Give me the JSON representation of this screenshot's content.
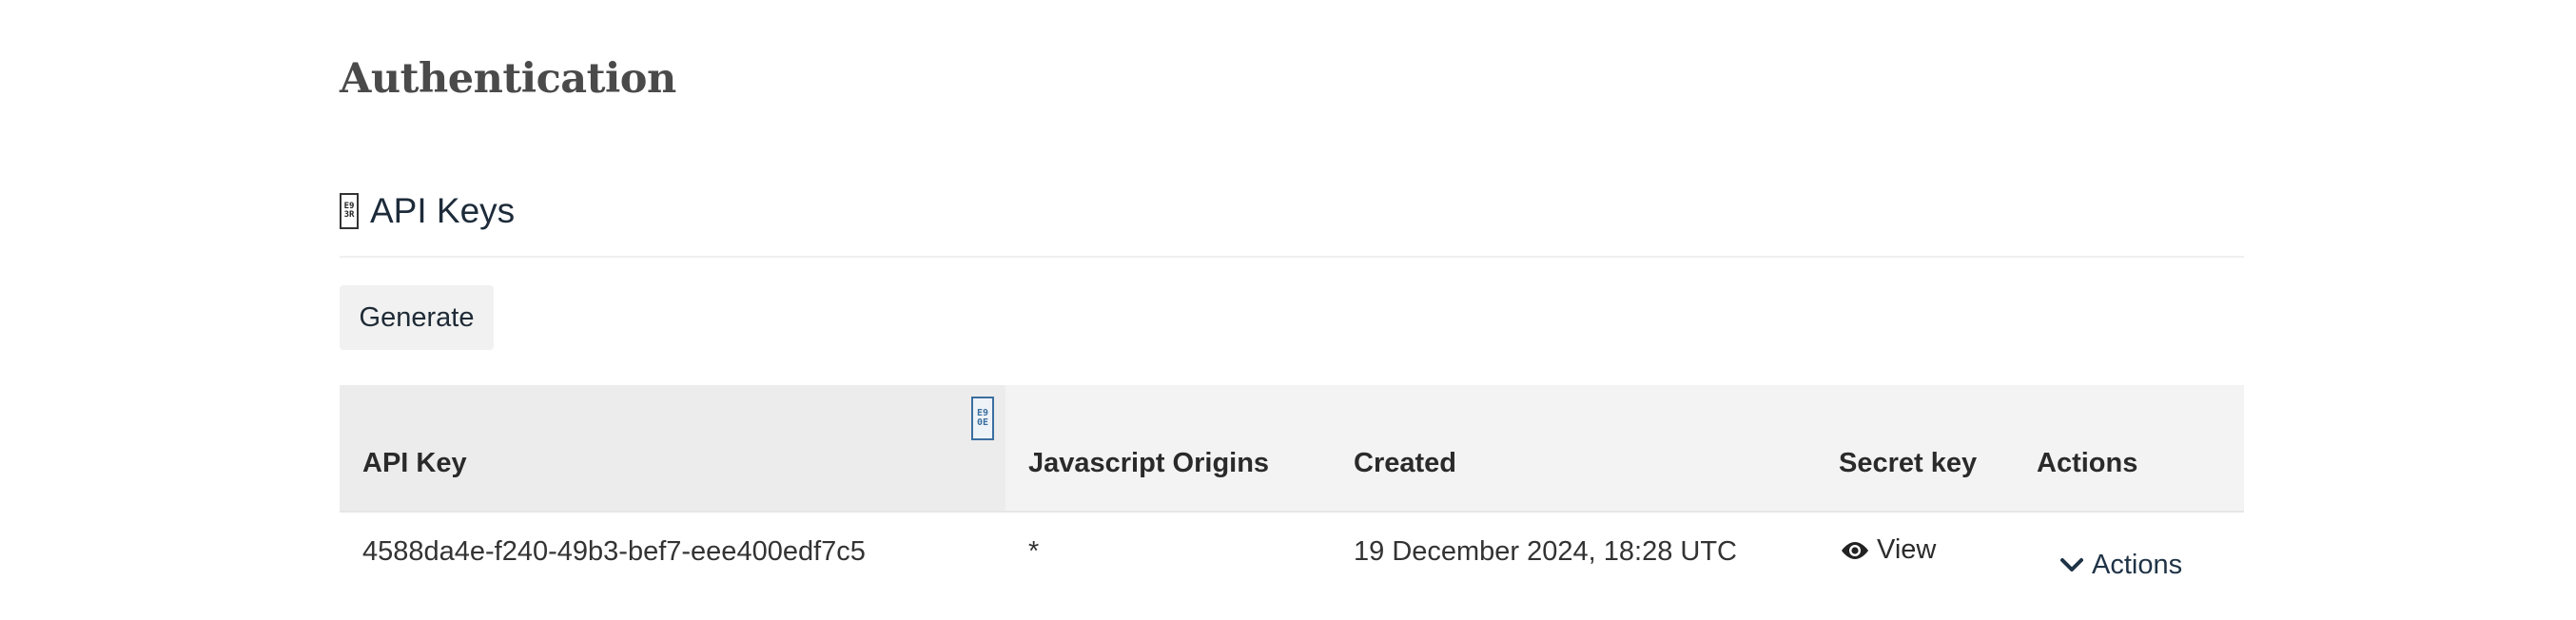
{
  "page": {
    "title": "Authentication"
  },
  "section": {
    "title": "API Keys",
    "icon": "missing-glyph-icon",
    "glyph_text": "E9\n3R"
  },
  "toolbar": {
    "generate_label": "Generate"
  },
  "table": {
    "sort_glyph_text": "E9\n0E",
    "columns": [
      {
        "key": "api_key",
        "label": "API Key"
      },
      {
        "key": "origins",
        "label": "Javascript Origins"
      },
      {
        "key": "created",
        "label": "Created"
      },
      {
        "key": "secret",
        "label": "Secret key"
      },
      {
        "key": "actions",
        "label": "Actions"
      }
    ],
    "rows": [
      {
        "api_key": "4588da4e-f240-49b3-bef7-eee400edf7c5",
        "origins": "*",
        "created": "19 December 2024, 18:28 UTC",
        "secret_action": "View",
        "actions_label": "Actions"
      }
    ]
  },
  "colors": {
    "text": "#2b2b2b",
    "header_bg": "#f3f3f3",
    "button_bg": "#f1f1f1"
  }
}
